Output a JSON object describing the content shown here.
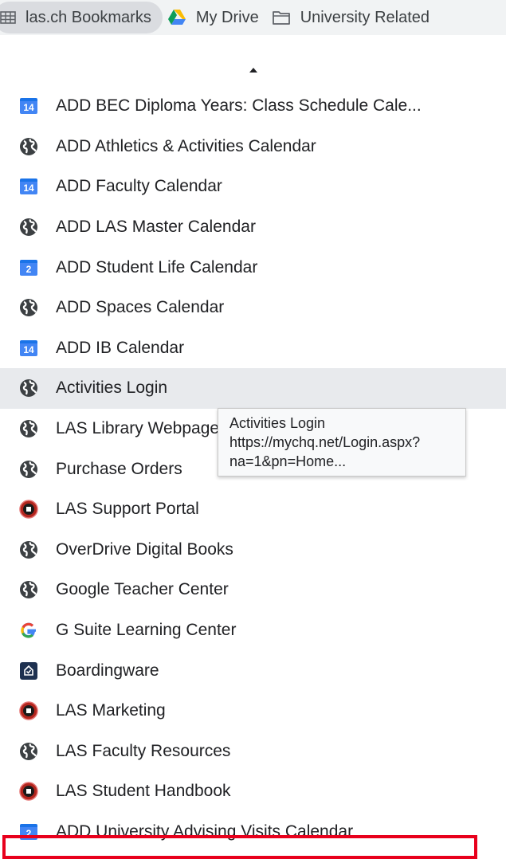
{
  "bookmarks_bar": {
    "items": [
      {
        "label": "las.ch Bookmarks",
        "icon": "grid-folder-icon"
      },
      {
        "label": "My Drive",
        "icon": "google-drive-icon"
      },
      {
        "label": "University Related",
        "icon": "folder-icon"
      }
    ]
  },
  "menu": {
    "items": [
      {
        "label": "ADD BEC Diploma Years: Class Schedule Cale...",
        "icon": "calendar-icon",
        "icon_text": "14"
      },
      {
        "label": "ADD Athletics & Activities Calendar",
        "icon": "globe-icon"
      },
      {
        "label": "ADD Faculty Calendar",
        "icon": "calendar-icon",
        "icon_text": "14"
      },
      {
        "label": "ADD LAS Master Calendar",
        "icon": "globe-icon"
      },
      {
        "label": "ADD Student Life Calendar",
        "icon": "calendar-icon",
        "icon_text": "2"
      },
      {
        "label": "ADD Spaces Calendar",
        "icon": "globe-icon"
      },
      {
        "label": "ADD IB Calendar",
        "icon": "calendar-icon",
        "icon_text": "14"
      },
      {
        "label": "Activities Login",
        "icon": "globe-icon",
        "hovered": true
      },
      {
        "label": "LAS Library Webpage",
        "icon": "globe-icon"
      },
      {
        "label": "Purchase Orders",
        "icon": "globe-icon"
      },
      {
        "label": "LAS Support Portal",
        "icon": "las-crest-icon"
      },
      {
        "label": "OverDrive Digital Books",
        "icon": "globe-icon"
      },
      {
        "label": "Google Teacher Center",
        "icon": "globe-icon"
      },
      {
        "label": "G Suite Learning Center",
        "icon": "google-g-icon"
      },
      {
        "label": "Boardingware",
        "icon": "boardingware-icon"
      },
      {
        "label": "LAS Marketing",
        "icon": "las-crest-icon"
      },
      {
        "label": "LAS Faculty Resources",
        "icon": "globe-icon"
      },
      {
        "label": "LAS Student Handbook",
        "icon": "las-crest-icon"
      },
      {
        "label": "ADD University Advising Visits Calendar",
        "icon": "calendar-icon",
        "icon_text": "2"
      }
    ]
  },
  "tooltip": {
    "title": "Activities Login",
    "url_line1": "https://mychq.net/Login.aspx?",
    "url_line2": "na=1&pn=Home..."
  },
  "colors": {
    "highlight": "#e8001c",
    "hover_bg": "#e8eaed",
    "calendar_blue": "#4285f4"
  }
}
